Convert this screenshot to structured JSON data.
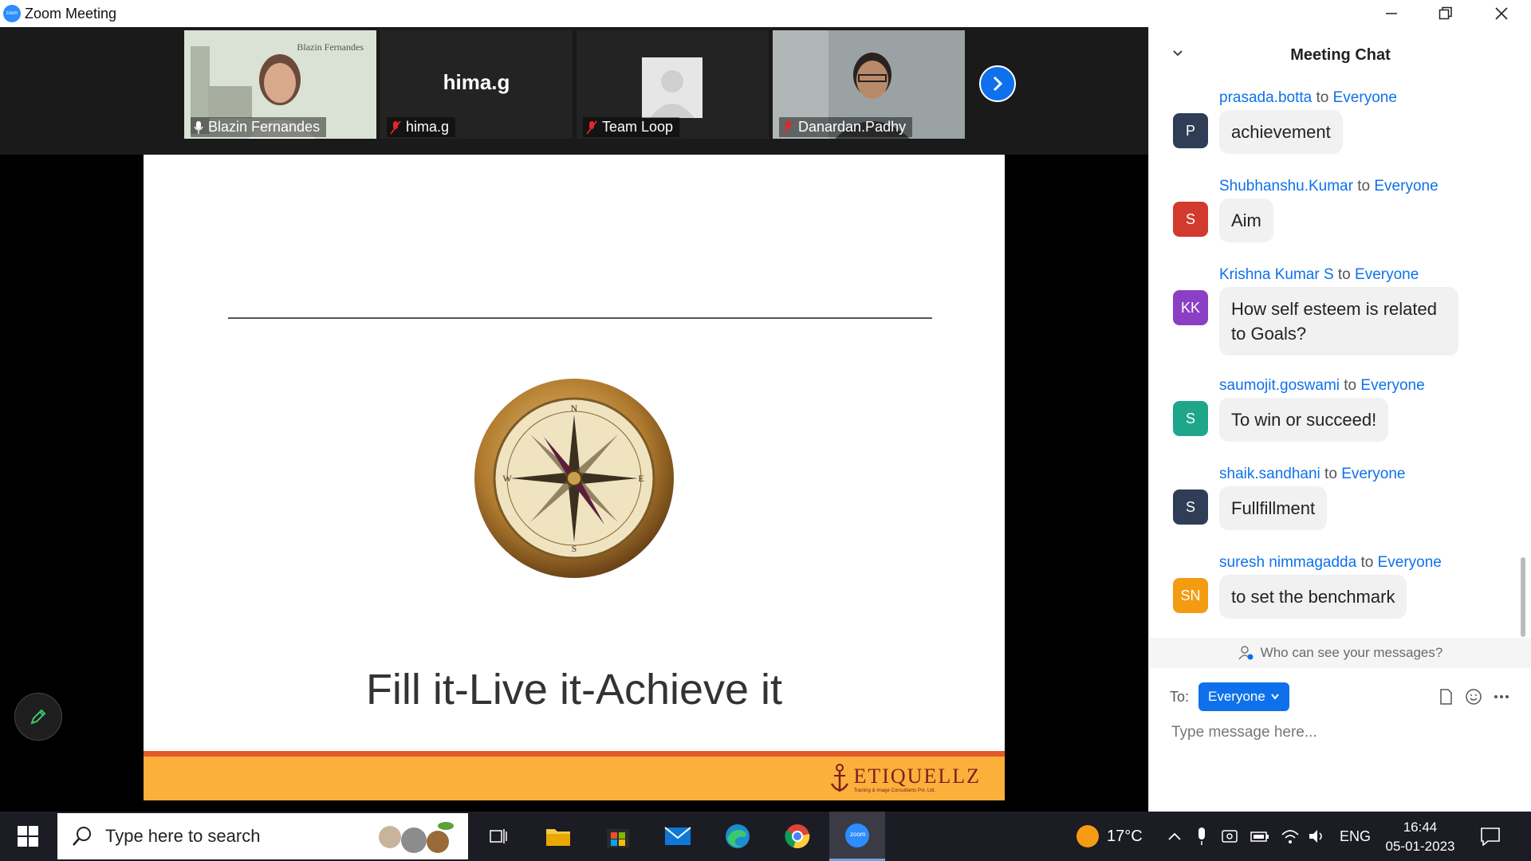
{
  "window": {
    "title": "Zoom Meeting",
    "app_logo_text": "zoom"
  },
  "participants": [
    {
      "name": "Blazin Fernandes",
      "video_watermark": "Blazin Fernandes",
      "active_speaker": true,
      "mic": "on"
    },
    {
      "name": "hima.g",
      "display_label": "hima.g",
      "mic": "muted"
    },
    {
      "name": "Team Loop",
      "mic": "muted",
      "avatar": "default-person"
    },
    {
      "name": "Danardan.Padhy",
      "mic": "muted"
    }
  ],
  "slide": {
    "title": "Fill it-Live it-Achieve it",
    "brand": "ETIQUELLZ",
    "brand_subtitle": "Training & Image Consultants Pvt. Ltd.",
    "image": "compass"
  },
  "chat": {
    "title": "Meeting Chat",
    "to_word": "to",
    "messages": [
      {
        "sender": "prasada.botta",
        "recipient": "Everyone",
        "initials": "P",
        "avatar_color": "#2f3e56",
        "text": "achievement"
      },
      {
        "sender": "Shubhanshu.Kumar",
        "recipient": "Everyone",
        "initials": "S",
        "avatar_color": "#d23a2f",
        "text": "Aim"
      },
      {
        "sender": "Krishna Kumar S",
        "recipient": "Everyone",
        "initials": "KK",
        "avatar_color": "#8a3fc5",
        "text": "How self esteem is related to Goals?"
      },
      {
        "sender": "saumojit.goswami",
        "recipient": "Everyone",
        "initials": "S",
        "avatar_color": "#1fa68a",
        "text": "To win or succeed!"
      },
      {
        "sender": "shaik.sandhani",
        "recipient": "Everyone",
        "initials": "S",
        "avatar_color": "#2f3e56",
        "text": "Fullfillment"
      },
      {
        "sender": "suresh nimmagadda",
        "recipient": "Everyone",
        "initials": "SN",
        "avatar_color": "#f39c12",
        "text": "to set the benchmark"
      }
    ],
    "privacy_hint": "Who can see your messages?",
    "to_label": "To:",
    "recipient_select": "Everyone",
    "input_placeholder": "Type message here..."
  },
  "taskbar": {
    "search_placeholder": "Type here to search",
    "weather_temp": "17°C",
    "language": "ENG",
    "time": "16:44",
    "date": "05-01-2023",
    "apps": [
      "task-view",
      "file-explorer",
      "microsoft-store",
      "mail",
      "edge",
      "chrome",
      "zoom"
    ],
    "zoom_label": "zoom"
  },
  "colors": {
    "accent": "#0e71eb",
    "active_speaker": "#9fd84a",
    "slide_footer": "#fbb03b",
    "slide_stripe": "#e4582a"
  }
}
